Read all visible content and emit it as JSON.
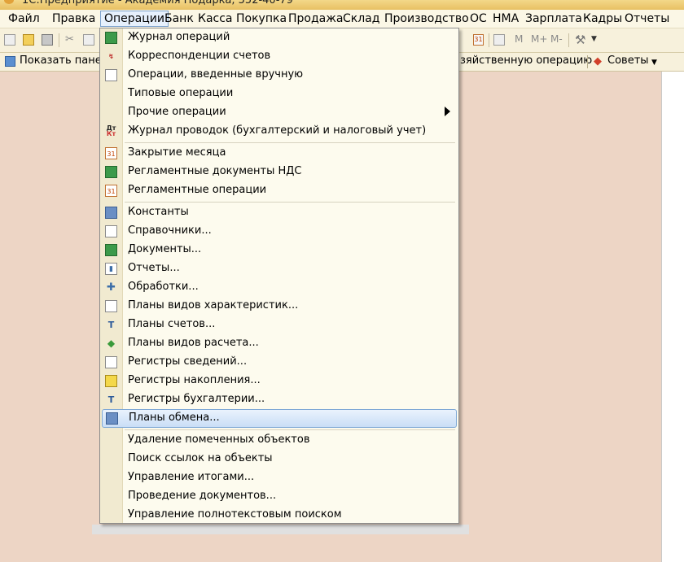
{
  "title_bar": {
    "title": "1С:Предприятие - Академия Подарка, 552-40-79"
  },
  "menu_bar": {
    "items": [
      {
        "label": "Файл"
      },
      {
        "label": "Правка"
      },
      {
        "label": "Операции",
        "active": true
      },
      {
        "label": "Банк"
      },
      {
        "label": "Касса"
      },
      {
        "label": "Покупка"
      },
      {
        "label": "Продажа"
      },
      {
        "label": "Склад"
      },
      {
        "label": "Производство"
      },
      {
        "label": "ОС"
      },
      {
        "label": "НМА"
      },
      {
        "label": "Зарплата"
      },
      {
        "label": "Кадры"
      },
      {
        "label": "Отчеты"
      }
    ]
  },
  "toolbar": {
    "memory_buttons": [
      "M",
      "M+",
      "M-"
    ],
    "calendar_text": "31"
  },
  "panel_bar": {
    "show_panel_label": "Показать панел",
    "business_op_label": "зяйственную операцию",
    "advice_label": "Советы"
  },
  "operations_menu": {
    "items": [
      {
        "label": "Журнал операций",
        "icon": "journal-green-icon"
      },
      {
        "label": "Корреспонденции счетов",
        "icon": "correspondence-icon"
      },
      {
        "label": "Операции, введенные вручную",
        "icon": "manual-doc-icon"
      },
      {
        "label": "Типовые операции",
        "icon": ""
      },
      {
        "label": "Прочие операции",
        "icon": "",
        "submenu": true
      },
      {
        "label": "Журнал проводок (бухгалтерский и налоговый учет)",
        "icon": "dt-kt-icon",
        "icon_text_top": "Дт",
        "icon_text_bottom": "Кт"
      },
      {
        "label": "Закрытие месяца",
        "icon": "calendar-icon",
        "icon_text": "31"
      },
      {
        "label": "Регламентные документы НДС",
        "icon": "journal-green-icon"
      },
      {
        "label": "Регламентные операции",
        "icon": "calendar-icon",
        "icon_text": "31"
      },
      {
        "label": "Константы",
        "icon": "constants-icon"
      },
      {
        "label": "Справочники...",
        "icon": "catalogs-icon"
      },
      {
        "label": "Документы...",
        "icon": "documents-icon"
      },
      {
        "label": "Отчеты...",
        "icon": "reports-icon"
      },
      {
        "label": "Обработки...",
        "icon": "processing-icon"
      },
      {
        "label": "Планы видов характеристик...",
        "icon": "characteristics-icon"
      },
      {
        "label": "Планы счетов...",
        "icon": "accounts-chart-icon"
      },
      {
        "label": "Планы видов расчета...",
        "icon": "calculation-types-icon"
      },
      {
        "label": "Регистры сведений...",
        "icon": "info-registers-icon"
      },
      {
        "label": "Регистры накопления...",
        "icon": "accumulation-registers-icon"
      },
      {
        "label": "Регистры бухгалтерии...",
        "icon": "accounting-registers-icon"
      },
      {
        "label": "Планы обмена...",
        "icon": "exchange-plans-icon",
        "highlighted": true
      },
      {
        "label": "Удаление помеченных объектов",
        "icon": ""
      },
      {
        "label": "Поиск ссылок на объекты",
        "icon": ""
      },
      {
        "label": "Управление итогами...",
        "icon": ""
      },
      {
        "label": "Проведение документов...",
        "icon": ""
      },
      {
        "label": "Управление полнотекстовым поиском",
        "icon": ""
      }
    ]
  },
  "colors": {
    "workarea_background": "#edd5c5",
    "menu_background": "#fdfbee",
    "highlight": "#c9def6"
  }
}
